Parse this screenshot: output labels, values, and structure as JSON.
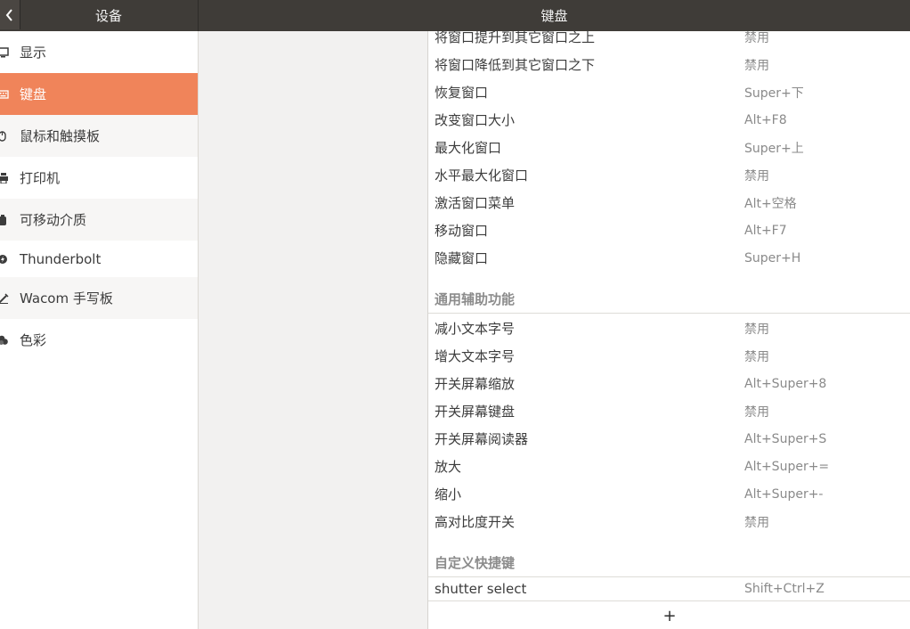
{
  "header": {
    "left_title": "设备",
    "main_title": "键盘",
    "back_icon": "chevron-left-icon"
  },
  "sidebar": {
    "selected_color": "#f0845a",
    "items": [
      {
        "label": "显示",
        "icon": "display-icon"
      },
      {
        "label": "键盘",
        "icon": "keyboard-icon",
        "selected": true
      },
      {
        "label": "鼠标和触摸板",
        "icon": "mouse-icon"
      },
      {
        "label": "打印机",
        "icon": "printer-icon"
      },
      {
        "label": "可移动介质",
        "icon": "removable-media-icon"
      },
      {
        "label": "Thunderbolt",
        "icon": "thunderbolt-icon"
      },
      {
        "label": "Wacom 手写板",
        "icon": "tablet-icon"
      },
      {
        "label": "色彩",
        "icon": "color-icon"
      }
    ]
  },
  "shortcuts": {
    "window_rows": [
      {
        "name": "将窗口提升到其它窗口之上",
        "key": "禁用"
      },
      {
        "name": "将窗口降低到其它窗口之下",
        "key": "禁用"
      },
      {
        "name": "恢复窗口",
        "key": "Super+下"
      },
      {
        "name": "改变窗口大小",
        "key": "Alt+F8"
      },
      {
        "name": "最大化窗口",
        "key": "Super+上"
      },
      {
        "name": "水平最大化窗口",
        "key": "禁用"
      },
      {
        "name": "激活窗口菜单",
        "key": "Alt+空格"
      },
      {
        "name": "移动窗口",
        "key": "Alt+F7"
      },
      {
        "name": "隐藏窗口",
        "key": "Super+H"
      }
    ],
    "accessibility_title": "通用辅助功能",
    "accessibility_rows": [
      {
        "name": "减小文本字号",
        "key": "禁用"
      },
      {
        "name": "增大文本字号",
        "key": "禁用"
      },
      {
        "name": "开关屏幕缩放",
        "key": "Alt+Super+8"
      },
      {
        "name": "开关屏幕键盘",
        "key": "禁用"
      },
      {
        "name": "开关屏幕阅读器",
        "key": "Alt+Super+S"
      },
      {
        "name": "放大",
        "key": "Alt+Super+="
      },
      {
        "name": "缩小",
        "key": "Alt+Super+-"
      },
      {
        "name": "高对比度开关",
        "key": "禁用"
      }
    ],
    "custom_title": "自定义快捷键",
    "custom_rows": [
      {
        "name": "shutter select",
        "key": "Shift+Ctrl+Z"
      }
    ],
    "add_label": "+"
  }
}
